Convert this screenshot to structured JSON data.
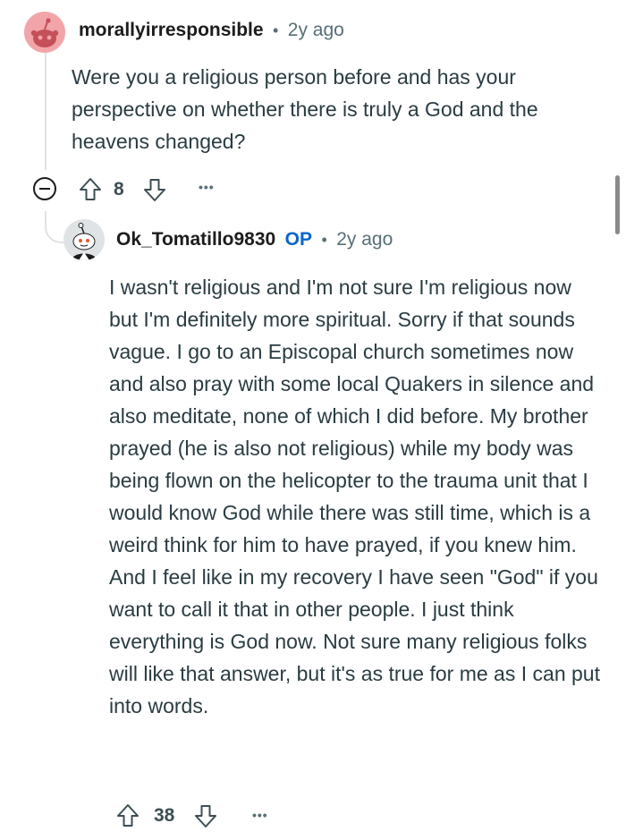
{
  "comment1": {
    "username": "morallyirresponsible",
    "separator": "•",
    "time": "2y ago",
    "text": "Were you a religious person before and has your perspective on whether there is truly a God and the heavens changed?",
    "votes": "8",
    "more": "•••",
    "avatar_color": "#f2a5a8"
  },
  "comment2": {
    "username": "Ok_Tomatillo9830",
    "op_badge": "OP",
    "separator": "•",
    "time": "2y ago",
    "text": "I wasn't religious and I'm not sure I'm religious now but I'm definitely more spiritual. Sorry if that sounds vague. I go to an Episcopal church sometimes now and also pray with some local Quakers in silence and also meditate, none of which I did before. My brother prayed (he is also not religious) while my body was being flown on the helicopter to the trauma unit that I would know God while there was still time, which is a weird think for him to have prayed, if you knew him. And I feel like in my recovery I have seen \"God\" if you want to call it that in other people. I just think everything is God now. Not sure many religious folks will like that answer, but it's as true for me as I can put into words.",
    "votes": "38",
    "more": "•••"
  },
  "colors": {
    "op_blue": "#0a65c8",
    "meta_gray": "#576f76",
    "thread_line": "#e0e2e4"
  }
}
